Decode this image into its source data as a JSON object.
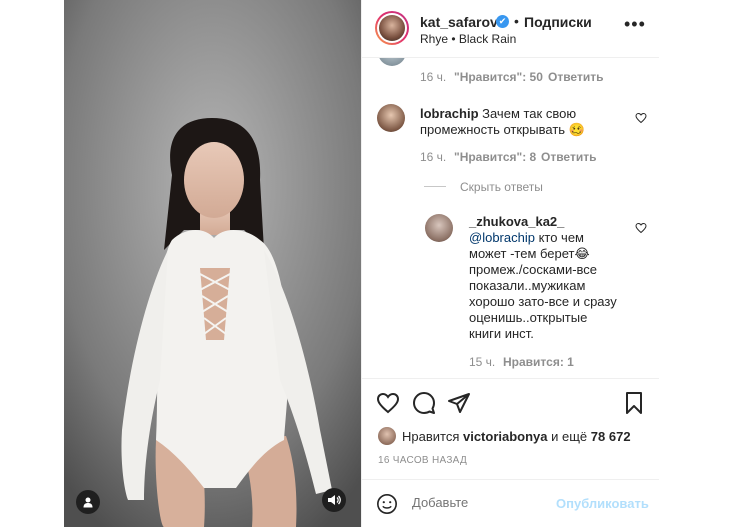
{
  "header": {
    "username": "kat_safarova",
    "verified_symbol": "✔",
    "separator": "•",
    "follow_label": "Подписки",
    "song": "Rhye • Black Rain",
    "more_label": "•••"
  },
  "comments": {
    "top_partial": {
      "time": "16 ч.",
      "likes": "\"Нравится\": 50",
      "reply": "Ответить"
    },
    "main": {
      "username": "lobrachip",
      "text_line1": "Зачем так свою",
      "text_line2": "промежность открывать 🥴",
      "time": "16 ч.",
      "likes": "\"Нравится\": 8",
      "reply": "Ответить"
    },
    "hide_replies": "Скрыть ответы",
    "reply": {
      "username": "_zhukova_ka2_",
      "mention": "@lobrachip",
      "line1_rest": " кто чем",
      "line2": "может -тем берет😂",
      "line3": "промеж./сосками-все",
      "line4": "показали..мужикам",
      "line5": "хорошо зато-все и сразу",
      "line6": "оценишь..открытые",
      "line7": "книги инст.",
      "time": "15 ч.",
      "likes": "Нравится: 1"
    }
  },
  "likes": {
    "prefix": "Нравится ",
    "user": "victoriabonya",
    "middle": " и ещё ",
    "count": "78 672"
  },
  "time_ago": "16 ЧАСОВ НАЗАД",
  "add_comment": {
    "placeholder": "Добавьте",
    "publish_label": "Опубликовать"
  },
  "colors": {
    "link_blue": "#00376b",
    "publish_disabled": "#b2dffc",
    "verified": "#3897f0"
  }
}
